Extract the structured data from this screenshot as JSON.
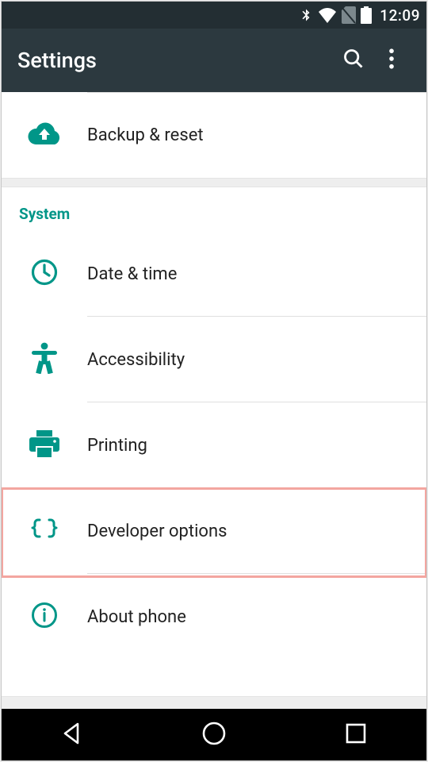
{
  "statusbar": {
    "time": "12:09"
  },
  "actionbar": {
    "title": "Settings"
  },
  "section_personal": {
    "items": [
      {
        "label": "Backup & reset"
      }
    ]
  },
  "section_system": {
    "header": "System",
    "items": [
      {
        "label": "Date & time"
      },
      {
        "label": "Accessibility"
      },
      {
        "label": "Printing"
      },
      {
        "label": "Developer options"
      },
      {
        "label": "About phone"
      }
    ]
  }
}
